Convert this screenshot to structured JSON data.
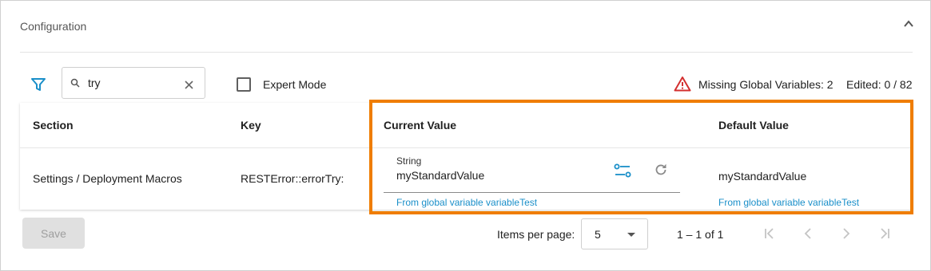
{
  "panel": {
    "title": "Configuration"
  },
  "toolbar": {
    "search_value": "try",
    "expert_mode_label": "Expert Mode",
    "expert_mode_checked": false,
    "missing_text": "Missing Global Variables: 2",
    "edited_text": "Edited: 0 / 82"
  },
  "table": {
    "headers": {
      "section": "Section",
      "key": "Key",
      "current": "Current Value",
      "default": "Default Value"
    },
    "rows": [
      {
        "section": "Settings / Deployment Macros",
        "key": "RESTError::errorTry:",
        "type": "String",
        "current_value": "myStandardValue",
        "current_hint": "From global variable variableTest",
        "default_value": "myStandardValue",
        "default_hint": "From global variable variableTest"
      }
    ]
  },
  "footer": {
    "save_label": "Save",
    "items_per_page_label": "Items per page:",
    "items_per_page_value": "5",
    "range_label": "1 – 1 of 1"
  },
  "colors": {
    "accent": "#1a8fc9",
    "highlight": "#ef7d00",
    "warning": "#d32f2f"
  },
  "icons": [
    "chevron-up-icon",
    "filter-icon",
    "search-icon",
    "clear-icon",
    "warning-icon",
    "variable-link-icon",
    "reset-icon",
    "first-page-icon",
    "prev-page-icon",
    "next-page-icon",
    "last-page-icon"
  ]
}
